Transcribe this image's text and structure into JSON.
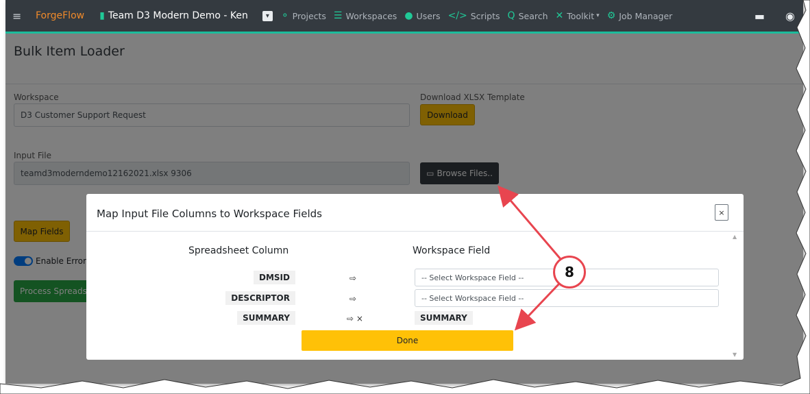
{
  "navbar": {
    "brand": "ForgeFlow",
    "team": "Team D3 Modern Demo - Ken",
    "items": [
      {
        "icon": "sitemap-icon",
        "glyph": "⚬",
        "label": "Projects"
      },
      {
        "icon": "list-icon",
        "glyph": "☰",
        "label": "Workspaces"
      },
      {
        "icon": "users-icon",
        "glyph": "●",
        "label": "Users"
      },
      {
        "icon": "code-icon",
        "glyph": "</>",
        "label": "Scripts"
      },
      {
        "icon": "search-icon",
        "glyph": "Q",
        "label": "Search"
      },
      {
        "icon": "tools-icon",
        "glyph": "✕",
        "label": "Toolkit"
      },
      {
        "icon": "gear-icon",
        "glyph": "⚙",
        "label": "Job Manager"
      }
    ]
  },
  "page": {
    "title": "Bulk Item Loader",
    "workspace_label": "Workspace",
    "workspace_value": "D3 Customer Support Request",
    "template_label": "Download XLSX Template",
    "download_button": "Download",
    "input_file_label": "Input File",
    "input_file_value": "teamd3moderndemo12162021.xlsx 9306",
    "browse_button": "Browse Files..",
    "map_fields_button": "Map Fields",
    "toggle_label": "Enable Error",
    "process_button": "Process Spreads"
  },
  "modal": {
    "title": "Map Input File Columns to Workspace Fields",
    "close_glyph": "×",
    "col_left": "Spreadsheet Column",
    "col_right": "Workspace Field",
    "rows": [
      {
        "column": "DMSID",
        "arrow": "⇨",
        "placeholder": "-- Select Workspace Field --"
      },
      {
        "column": "DESCRIPTOR",
        "arrow": "⇨",
        "placeholder": "-- Select Workspace Field --"
      },
      {
        "column": "SUMMARY",
        "arrow": "⇨ ×",
        "field": "SUMMARY"
      }
    ],
    "done_button": "Done"
  },
  "callout": {
    "number": "8"
  },
  "colors": {
    "navbar_bg": "#343a40",
    "accent": "#1bbc9b",
    "button_yellow": "#ffc107",
    "button_green": "#28a745",
    "callout_red": "#e8454f"
  }
}
